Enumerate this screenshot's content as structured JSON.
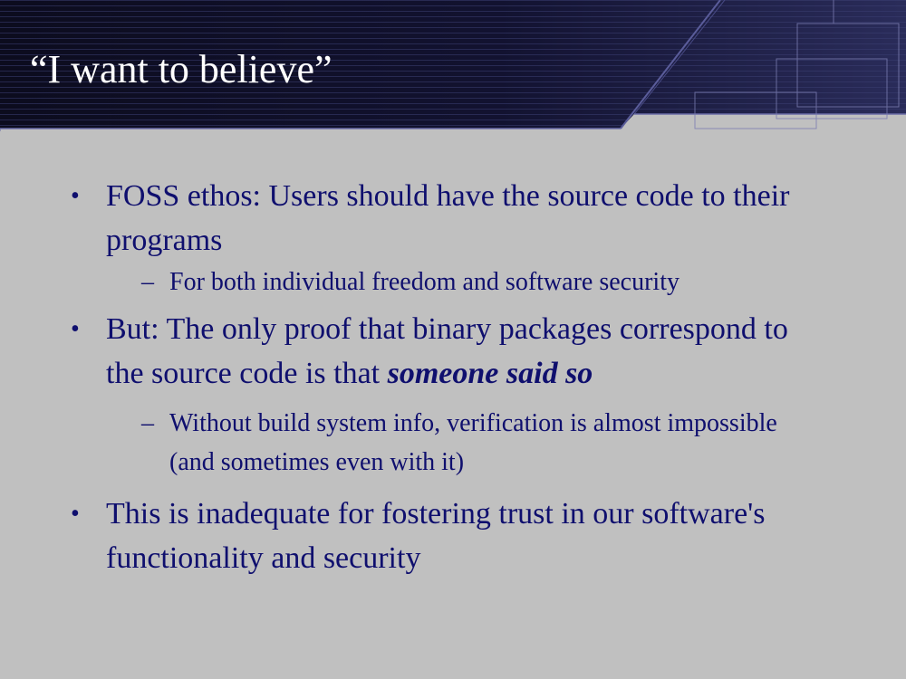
{
  "slide": {
    "title": "“I want to believe”",
    "colors": {
      "header_dark": "#0e0e22",
      "header_lines": "#3a3c6e",
      "body_background": "#c0c0c0",
      "text": "#0f0f6e",
      "title_text": "#ffffff"
    },
    "bullets": [
      {
        "text": "FOSS ethos: Users should have the source code to their programs",
        "subitems": [
          {
            "text": "For both individual freedom and software security"
          }
        ]
      },
      {
        "text_before": "But: The only proof that binary packages correspond to the source code is that ",
        "text_emphasis": "someone said so",
        "subitems": [
          {
            "text": "Without build system info, verification is almost impossible (and sometimes even with it)"
          }
        ]
      },
      {
        "text": "This is inadequate for fostering trust in our software's functionality and security",
        "subitems": []
      }
    ],
    "bullet_glyph": "•",
    "sub_glyph": "–"
  }
}
